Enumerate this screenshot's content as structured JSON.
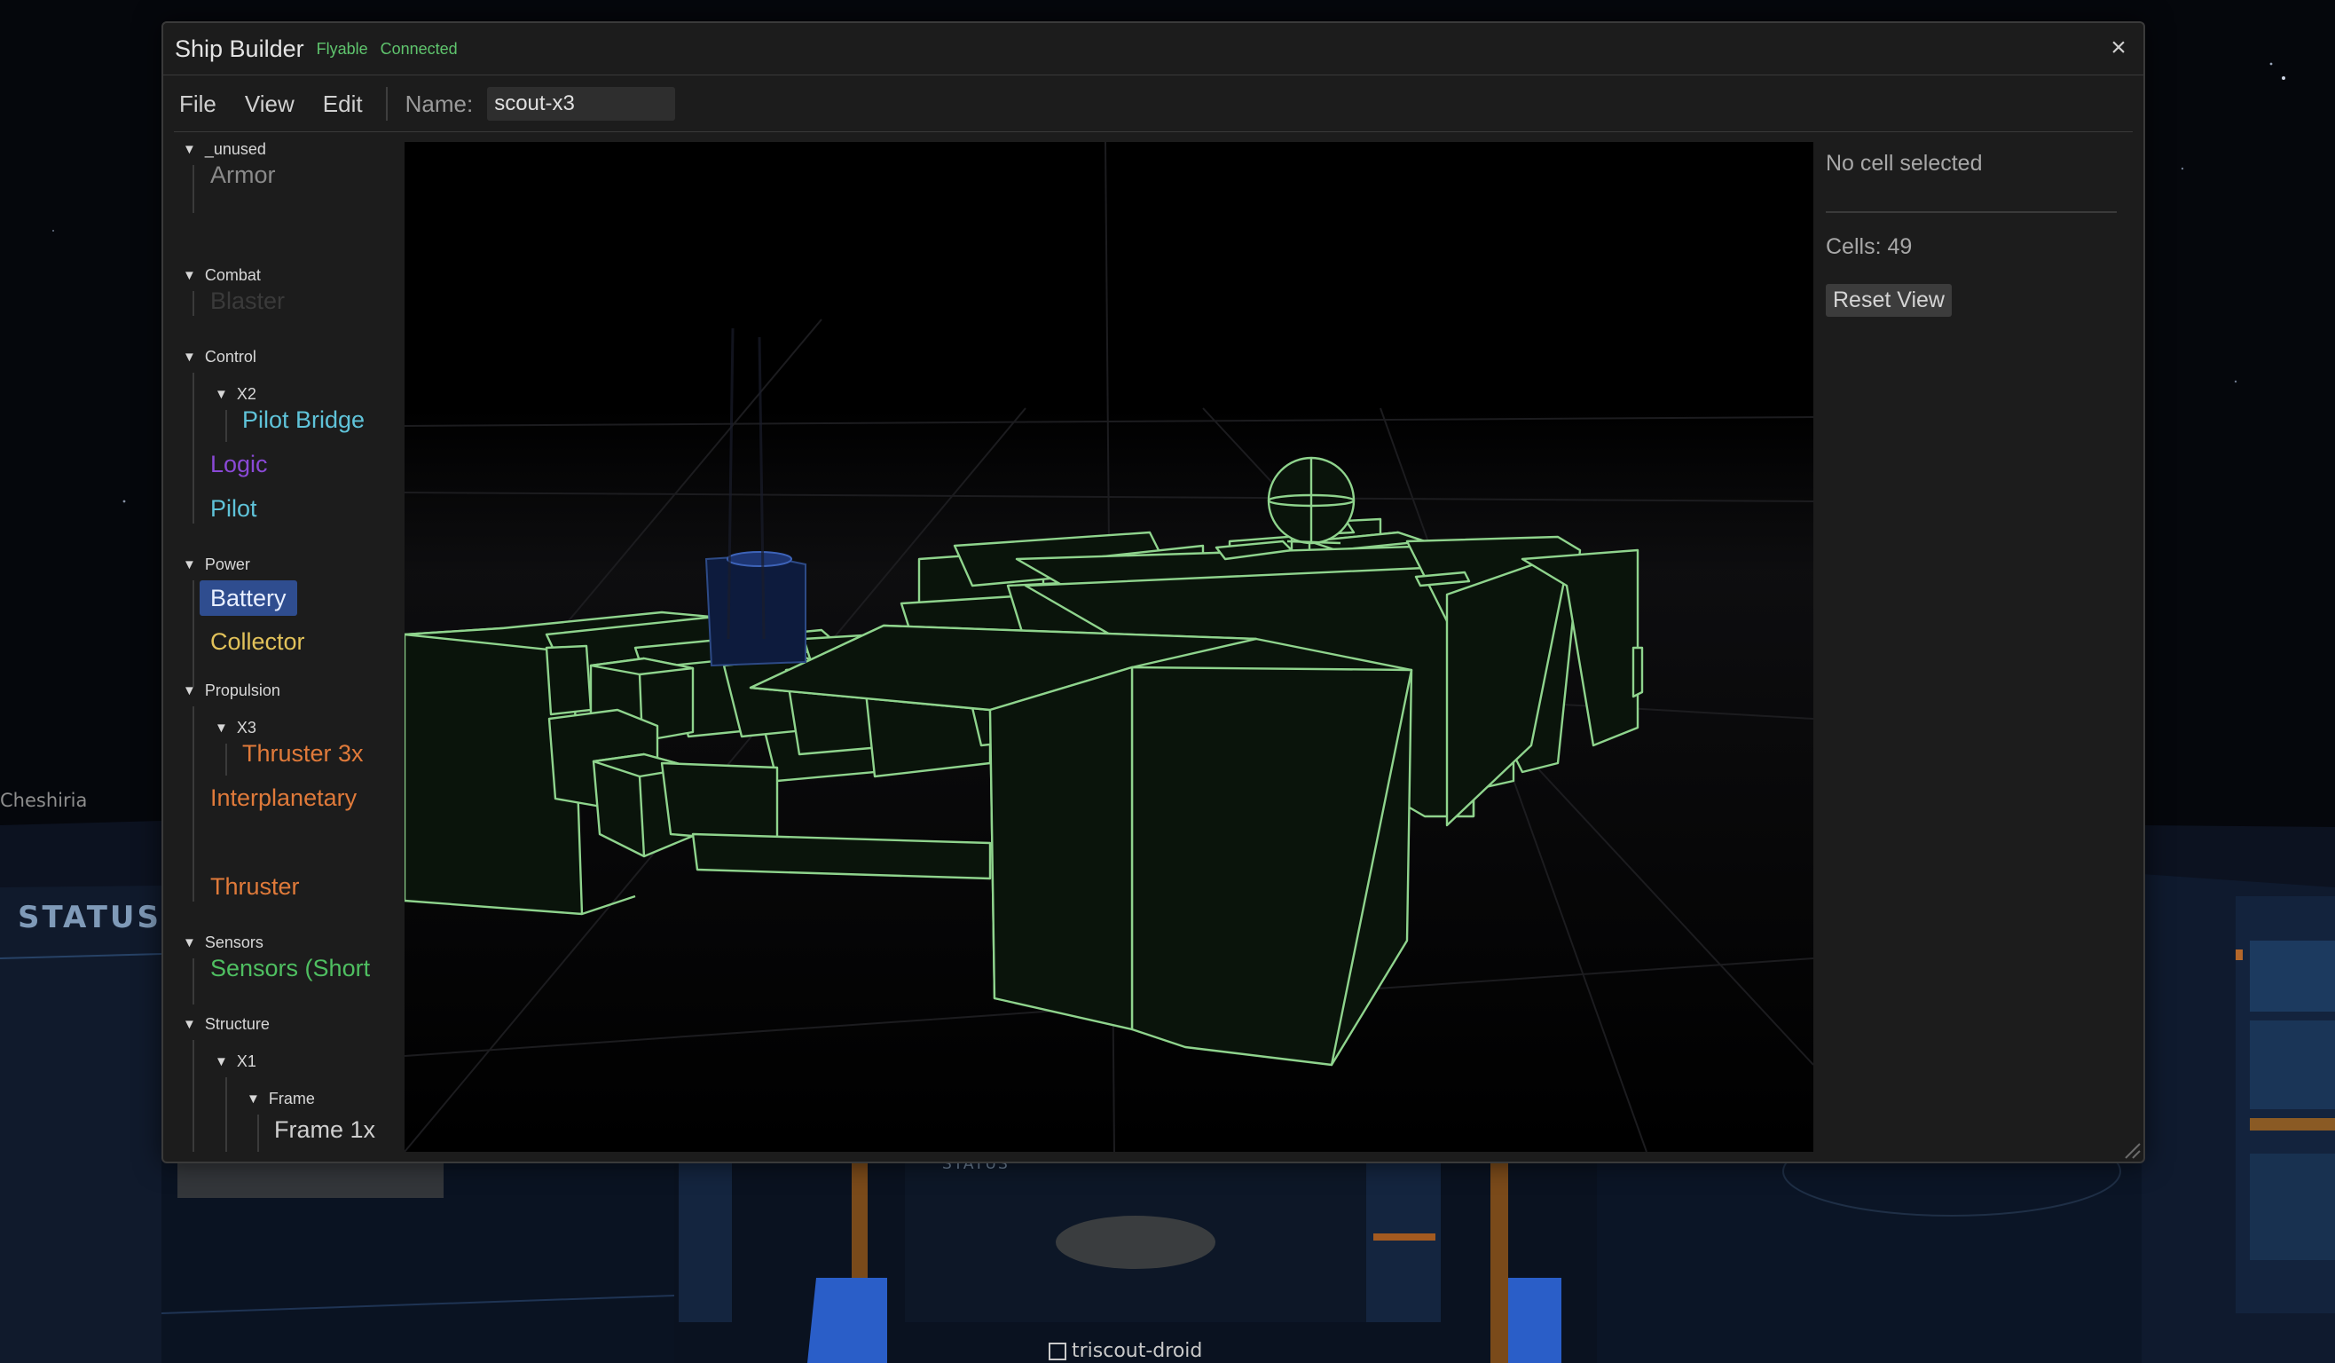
{
  "window": {
    "title": "Ship Builder",
    "badges": [
      "Flyable",
      "Connected"
    ],
    "close_icon": "×"
  },
  "toolbar": {
    "menu": [
      "File",
      "View",
      "Edit"
    ],
    "name_label": "Name:",
    "name_value": "scout-x3"
  },
  "tree": {
    "groups": {
      "unused": "_unused",
      "combat": "Combat",
      "control": "Control",
      "control_x2": "X2",
      "power": "Power",
      "propulsion": "Propulsion",
      "propulsion_x3": "X3",
      "sensors": "Sensors",
      "structure": "Structure",
      "structure_x1": "X1",
      "structure_frame": "Frame"
    },
    "leaves": {
      "armor": "Armor",
      "blaster": "Blaster",
      "pilot_bridge": "Pilot Bridge",
      "logic": "Logic",
      "pilot": "Pilot",
      "battery": "Battery",
      "collector": "Collector",
      "thruster_3x": "Thruster 3x",
      "interplanetary": "Interplanetary",
      "thruster": "Thruster",
      "sensors_short": "Sensors (Short",
      "frame_1x": "Frame 1x"
    },
    "colors": {
      "armor": "#8a8a8a",
      "blaster": "#3a3a3a",
      "pilot_bridge": "#5fc3d9",
      "logic": "#8a49d6",
      "pilot": "#5fc3d9",
      "battery_bg": "#2f4d8f",
      "collector": "#e2c25a",
      "propulsion": "#e07a3a",
      "sensors": "#4fbf61"
    },
    "selected": "Battery"
  },
  "panel": {
    "selection": "No cell selected",
    "cells": "Cells: 49",
    "reset_label": "Reset View"
  },
  "background": {
    "status_left": "STATUS",
    "status_center": "STATUS",
    "player_name": "Cheshiria",
    "droid_name": "triscout-droid"
  }
}
